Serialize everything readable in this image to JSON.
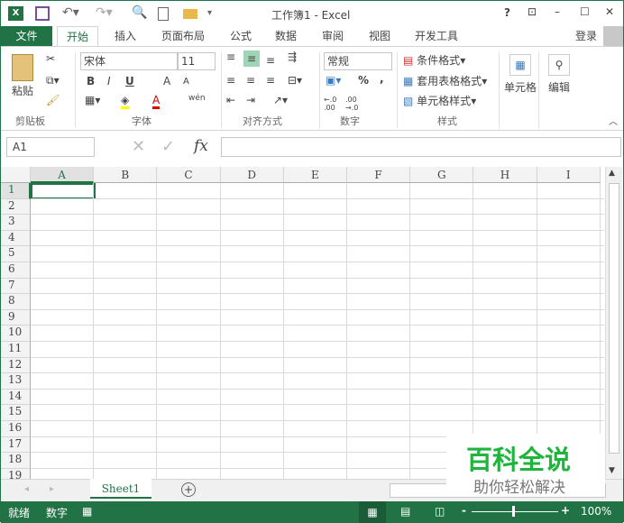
{
  "title": "工作簿1 - Excel",
  "title_controls": {
    "help": "?",
    "ribbon_display": "⊡",
    "minimize": "–",
    "maximize": "☐",
    "close": "✕"
  },
  "tabs": {
    "file": "文件",
    "items": [
      "开始",
      "插入",
      "页面布局",
      "公式",
      "数据",
      "审阅",
      "视图",
      "开发工具"
    ],
    "login": "登录"
  },
  "ribbon": {
    "clipboard": {
      "paste": "粘贴",
      "label": "剪贴板"
    },
    "font": {
      "name": "宋体",
      "size": "11",
      "bold": "B",
      "italic": "I",
      "underline": "U",
      "grow": "A",
      "shrink": "A",
      "font_color": "A",
      "phonetic": "wén",
      "label": "字体"
    },
    "alignment": {
      "label": "对齐方式"
    },
    "number": {
      "format": "常规",
      "percent": "%",
      "comma": ",",
      "inc": "←.0 .00",
      "dec": ".00 →.0",
      "label": "数字"
    },
    "styles": {
      "conditional": "条件格式",
      "table": "套用表格格式",
      "cell": "单元格样式",
      "label": "样式"
    },
    "cells": {
      "label": "单元格"
    },
    "editing": {
      "label": "编辑"
    },
    "colors": {
      "highlight": "#ffff00",
      "font": "#e00000",
      "accent": "#217346"
    }
  },
  "formula_bar": {
    "name_box": "A1",
    "cancel": "✕",
    "enter": "✓",
    "fx": "fx",
    "value": ""
  },
  "columns": [
    "A",
    "B",
    "C",
    "D",
    "E",
    "F",
    "G",
    "H",
    "I"
  ],
  "rows": [
    "1",
    "2",
    "3",
    "4",
    "5",
    "6",
    "7",
    "8",
    "9",
    "10",
    "11",
    "12",
    "13",
    "14",
    "15",
    "16",
    "17",
    "18",
    "19"
  ],
  "sheet_tabs": [
    "Sheet1"
  ],
  "status": {
    "ready": "就绪",
    "mode": "数字",
    "zoom": "100%",
    "minus": "-",
    "plus": "+"
  },
  "watermark": {
    "title": "百科全说",
    "subtitle": "助你轻松解决"
  }
}
